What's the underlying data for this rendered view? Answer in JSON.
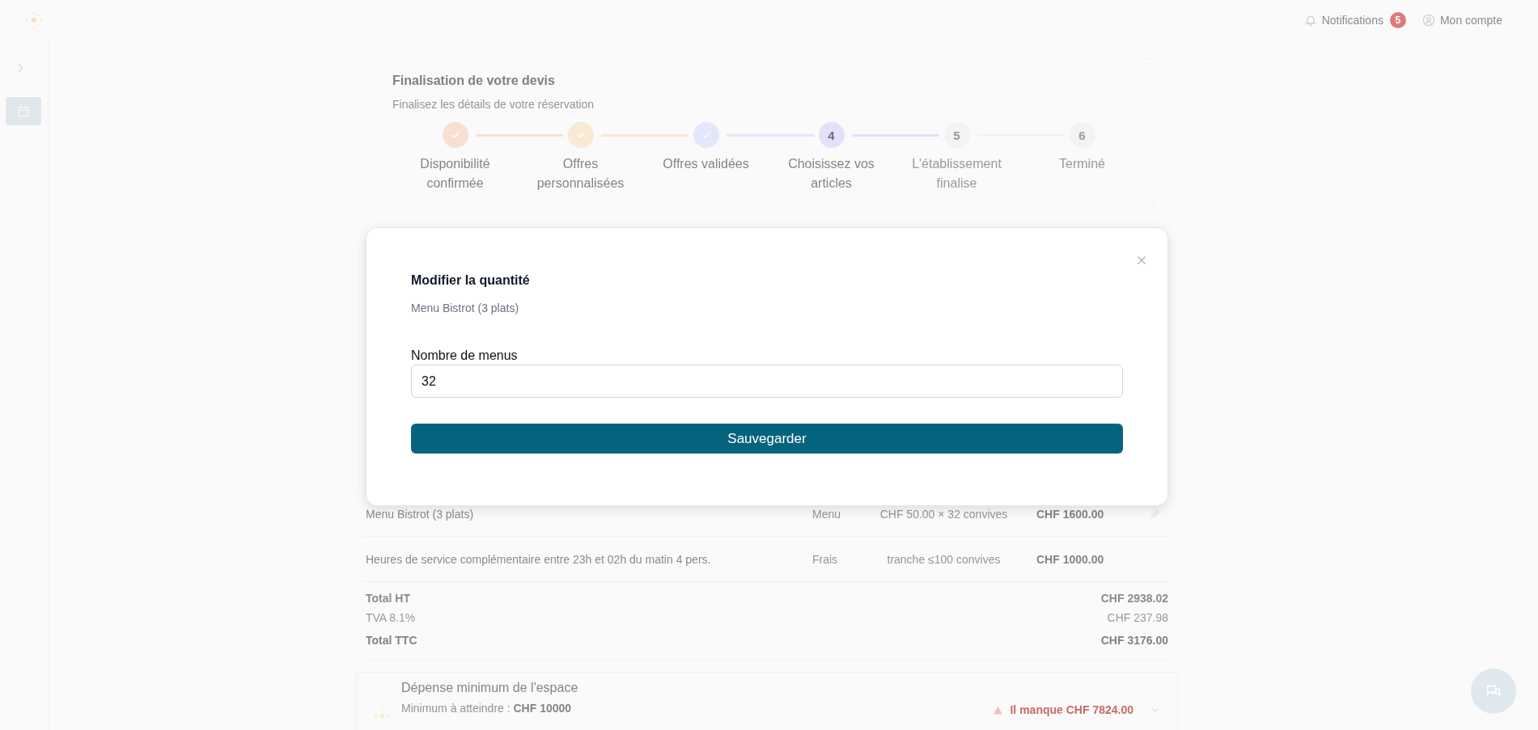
{
  "header": {
    "notifications": {
      "label": "Notifications",
      "count": "5"
    },
    "account": {
      "label": "Mon compte"
    }
  },
  "quote_progress": {
    "title": "Finalisation de votre devis",
    "subtitle": "Finalisez les détails de votre réservation",
    "steps": [
      {
        "label": "Disponibilité confirmée",
        "done": true,
        "current": false,
        "color": "#f7e0d2"
      },
      {
        "label": "Offres personnalisées",
        "done": true,
        "current": false,
        "color": "#f9e8d3"
      },
      {
        "label": "Offres validées",
        "done": true,
        "current": false,
        "color": "#e2e7f9"
      },
      {
        "label": "Choisissez vos articles",
        "done": false,
        "current": true,
        "number": "4",
        "color": "#e3e1f7"
      },
      {
        "label": "L'établissement finalise",
        "done": false,
        "current": false,
        "number": "5",
        "color": "#f3f3f3"
      },
      {
        "label": "Terminé",
        "done": false,
        "current": false,
        "number": "6",
        "color": "#f3f3f3"
      }
    ]
  },
  "items": [
    {
      "name": "Menu Bistrot (3 plats)",
      "type": "Menu",
      "detail": "CHF 50.00 × 32 convives",
      "price": "CHF 1600.00",
      "editable": true
    },
    {
      "name": "Heures de service complémentaire entre 23h et 02h du matin 4 pers.",
      "type": "Frais",
      "detail": "tranche ≤100 convives",
      "price": "CHF 1000.00",
      "editable": false
    }
  ],
  "totals": [
    {
      "label": "Total HT",
      "value": "CHF 2938.02",
      "kind": "subtotal"
    },
    {
      "label": "TVA 8.1%",
      "value": "CHF 237.98",
      "kind": "tax"
    },
    {
      "label": "Total TTC",
      "value": "CHF 3176.00",
      "kind": "total"
    }
  ],
  "minimum_spend": {
    "title": "Dépense minimum de l'espace",
    "minimum_label": "Minimum à atteindre :",
    "minimum_value": "CHF 10000",
    "warning": "Il manque CHF 7824.00"
  },
  "modal": {
    "title": "Modifier la quantité",
    "subtitle": "Menu Bistrot (3 plats)",
    "field_label": "Nombre de menus",
    "value": "32",
    "button": "Sauvegarder"
  }
}
